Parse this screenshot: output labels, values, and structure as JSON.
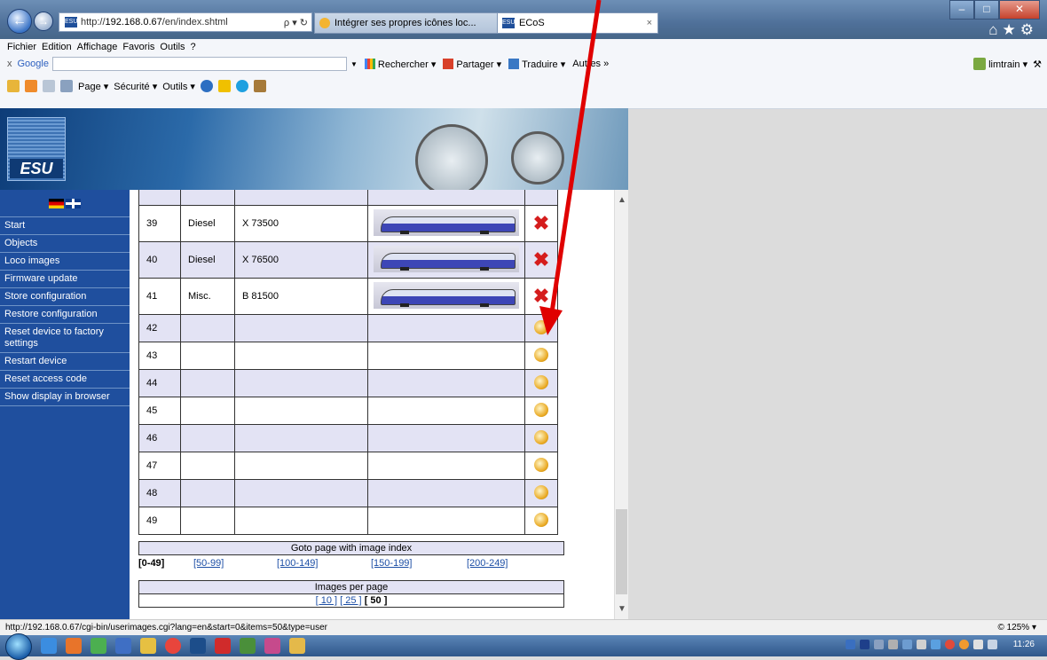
{
  "browser": {
    "address": {
      "prefix": "http://",
      "host": "192.168.0.67",
      "path": "/en/index.shtml",
      "favicon": "ESU"
    },
    "address_controls": "ρ ▾ ↻",
    "tabs": [
      {
        "title": "Intégrer ses propres icônes loc..."
      },
      {
        "title": "ECoS",
        "close": "×"
      }
    ],
    "window_controls": {
      "minimize": "–",
      "maximize": "□",
      "close": "✕"
    },
    "top_icons": "⌂★⚙",
    "menu": [
      "Fichier",
      "Edition",
      "Affichage",
      "Favoris",
      "Outils",
      "?"
    ],
    "google_toolbar": {
      "close": "x",
      "logo": "Google",
      "buttons": [
        "Rechercher ▾",
        "Partager ▾",
        "Traduire ▾",
        "Autres »"
      ],
      "user": "limtrain ▾"
    },
    "command_bar": [
      "Page ▾",
      "Sécurité ▾",
      "Outils ▾"
    ]
  },
  "site": {
    "logo_text": "ESU",
    "nav": [
      "Start",
      "Objects",
      "Loco images",
      "Firmware update",
      "Store configuration",
      "Restore configuration",
      "Reset device to factory settings",
      "Restart device",
      "Reset access code",
      "Show display in browser"
    ]
  },
  "images_table": {
    "rows": [
      {
        "index": "",
        "type": "",
        "name": "",
        "has_image": true,
        "image_style": "red",
        "action": "none"
      },
      {
        "index": "39",
        "type": "Diesel",
        "name": "X 73500",
        "has_image": true,
        "action": "delete"
      },
      {
        "index": "40",
        "type": "Diesel",
        "name": "X 76500",
        "has_image": true,
        "action": "delete"
      },
      {
        "index": "41",
        "type": "Misc.",
        "name": "B 81500",
        "has_image": true,
        "action": "delete"
      },
      {
        "index": "42",
        "type": "",
        "name": "",
        "has_image": false,
        "action": "upload"
      },
      {
        "index": "43",
        "type": "",
        "name": "",
        "has_image": false,
        "action": "upload"
      },
      {
        "index": "44",
        "type": "",
        "name": "",
        "has_image": false,
        "action": "upload"
      },
      {
        "index": "45",
        "type": "",
        "name": "",
        "has_image": false,
        "action": "upload"
      },
      {
        "index": "46",
        "type": "",
        "name": "",
        "has_image": false,
        "action": "upload"
      },
      {
        "index": "47",
        "type": "",
        "name": "",
        "has_image": false,
        "action": "upload"
      },
      {
        "index": "48",
        "type": "",
        "name": "",
        "has_image": false,
        "action": "upload"
      },
      {
        "index": "49",
        "type": "",
        "name": "",
        "has_image": false,
        "action": "upload"
      }
    ],
    "delete_glyph": "✖"
  },
  "goto": {
    "header": "Goto page with image index",
    "current": "[0-49]",
    "links": [
      "[50-99]",
      "[100-149]",
      "[150-199]",
      "[200-249]"
    ]
  },
  "per_page": {
    "header": "Images per page",
    "links": [
      "[ 10 ]",
      "[ 25 ]"
    ],
    "current": "[ 50 ]"
  },
  "status": {
    "url": "http://192.168.0.67/cgi-bin/userimages.cgi?lang=en&start=0&items=50&type=user",
    "zoom": "© 125%  ▾"
  },
  "taskbar": {
    "clock": "11:26"
  },
  "colors": {
    "sidebar": "#1f4f9e",
    "row_alt": "#e3e3f4",
    "arrow": "#e00000",
    "link": "#1d4fa6"
  }
}
